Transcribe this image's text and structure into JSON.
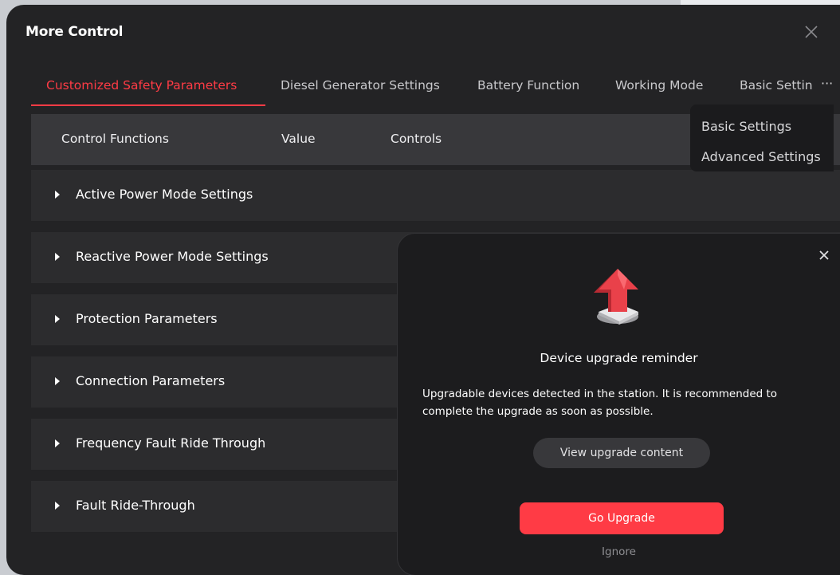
{
  "window": {
    "title": "More Control"
  },
  "tabs": [
    {
      "label": "Customized Safety Parameters",
      "active": true
    },
    {
      "label": "Diesel Generator Settings",
      "active": false
    },
    {
      "label": "Battery Function",
      "active": false
    },
    {
      "label": "Working Mode",
      "active": false
    },
    {
      "label": "Basic Settin",
      "active": false
    }
  ],
  "tab_more_label": "···",
  "table": {
    "columns": [
      "Control Functions",
      "Value",
      "Controls"
    ],
    "rows": [
      {
        "label": "Active Power Mode Settings"
      },
      {
        "label": "Reactive Power Mode Settings"
      },
      {
        "label": "Protection Parameters"
      },
      {
        "label": "Connection Parameters"
      },
      {
        "label": "Frequency Fault Ride Through"
      },
      {
        "label": "Fault Ride-Through"
      }
    ]
  },
  "dropdown": {
    "items": [
      "Basic Settings",
      "Advanced Settings"
    ]
  },
  "dialog": {
    "title": "Device upgrade reminder",
    "message": "Upgradable devices detected in the station. It is recommended to complete the upgrade as soon as possible.",
    "view_button": "View upgrade content",
    "primary_button": "Go Upgrade",
    "ignore_link": "Ignore",
    "icon": "upgrade-arrow-icon"
  },
  "colors": {
    "accent": "#ff3b45",
    "window_bg": "#232325",
    "row_bg": "#2c2c2e",
    "header_bg": "#38383b",
    "dialog_bg": "#1c1c1e"
  }
}
